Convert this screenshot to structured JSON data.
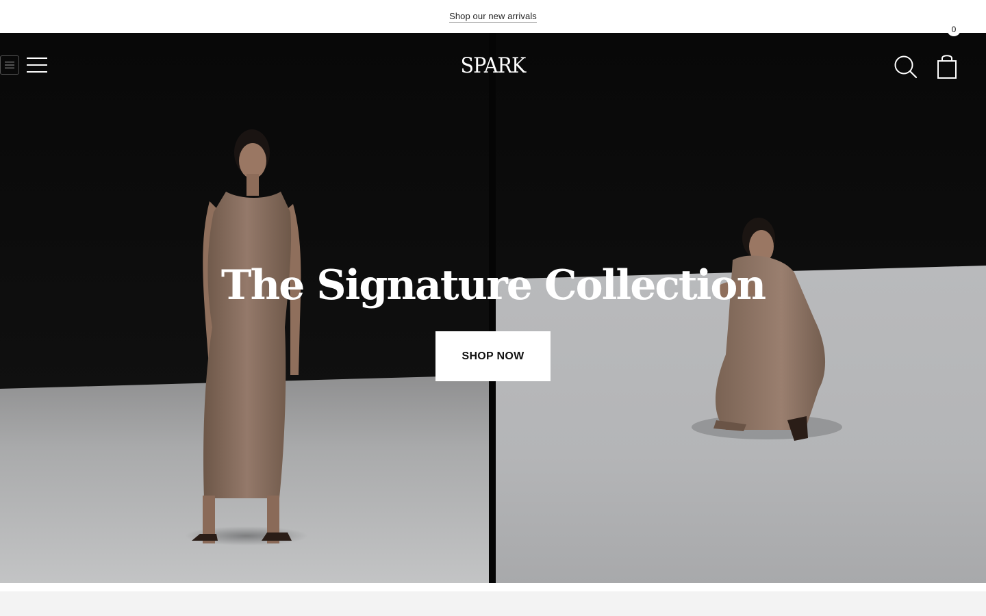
{
  "announcement": {
    "link_label": "Shop our new arrivals"
  },
  "header": {
    "logo": "SPARK",
    "menu_icon": "hamburger-icon",
    "search_icon": "search-icon",
    "cart_icon": "shopping-bag-icon",
    "cart_count": "0"
  },
  "hero": {
    "title": "The Signature Collection",
    "cta_label": "SHOP NOW"
  },
  "colors": {
    "announcement_bg": "#ffffff",
    "hero_dark": "#0b0b0b",
    "floor_light": "#c8c9ca",
    "dress": "#8d7565",
    "text_on_hero": "#ffffff",
    "button_bg": "#ffffff",
    "button_text": "#111111",
    "page_bg": "#f3f3f3"
  }
}
